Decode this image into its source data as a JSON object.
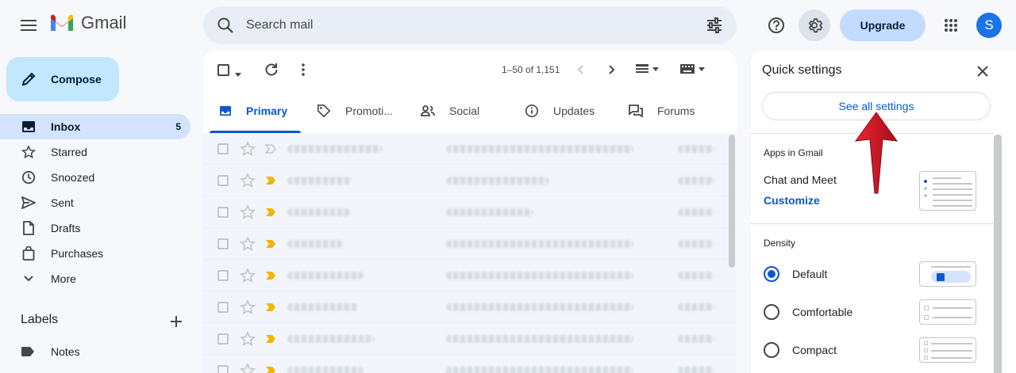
{
  "header": {
    "logo_text": "Gmail",
    "search_placeholder": "Search mail",
    "upgrade_label": "Upgrade",
    "avatar_letter": "S"
  },
  "sidebar": {
    "compose_label": "Compose",
    "items": [
      {
        "label": "Inbox",
        "count": "5",
        "icon": "inbox-icon"
      },
      {
        "label": "Starred",
        "icon": "star-icon"
      },
      {
        "label": "Snoozed",
        "icon": "clock-icon"
      },
      {
        "label": "Sent",
        "icon": "send-icon"
      },
      {
        "label": "Drafts",
        "icon": "draft-icon"
      },
      {
        "label": "Purchases",
        "icon": "bag-icon"
      },
      {
        "label": "More",
        "icon": "chevron-down-icon"
      }
    ],
    "labels_title": "Labels",
    "labels": [
      {
        "label": "Notes",
        "icon": "label-icon"
      }
    ]
  },
  "toolbar": {
    "pager_text": "1–50 of 1,151"
  },
  "tabs": [
    {
      "label": "Primary",
      "icon": "inbox-icon",
      "active": true
    },
    {
      "label": "Promoti...",
      "icon": "tag-icon"
    },
    {
      "label": "Social",
      "icon": "people-icon"
    },
    {
      "label": "Updates",
      "icon": "info-icon"
    },
    {
      "label": "Forums",
      "icon": "forum-icon"
    }
  ],
  "quick_settings": {
    "title": "Quick settings",
    "see_all_label": "See all settings",
    "apps_title": "Apps in Gmail",
    "chat_meet_label": "Chat and Meet",
    "customize_label": "Customize",
    "density_title": "Density",
    "density_options": [
      {
        "label": "Default",
        "selected": true
      },
      {
        "label": "Comfortable",
        "selected": false
      },
      {
        "label": "Compact",
        "selected": false
      }
    ]
  },
  "colors": {
    "accent": "#0b57d0",
    "compose_bg": "#c2e7ff",
    "arrow": "#c8102e",
    "important_marker": "#f4b400"
  }
}
